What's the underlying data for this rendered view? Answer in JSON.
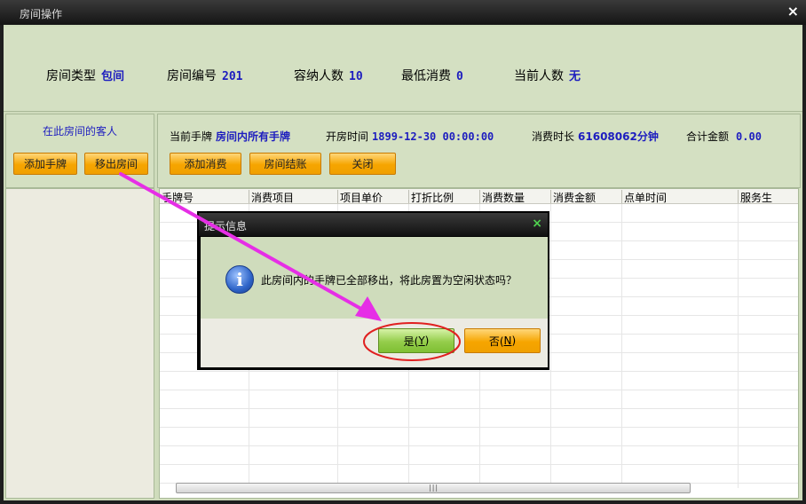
{
  "window": {
    "title": "房间操作",
    "close_label": "×"
  },
  "room_info": {
    "type_label": "房间类型",
    "type_value": "包间",
    "number_label": "房间编号",
    "number_value": "201",
    "capacity_label": "容纳人数",
    "capacity_value": "10",
    "min_spend_label": "最低消费",
    "min_spend_value": "0",
    "current_people_label": "当前人数",
    "current_people_value": "无"
  },
  "guests": {
    "heading": "在此房间的客人",
    "add_button": "添加手牌",
    "remove_button": "移出房间"
  },
  "session": {
    "card_label": "当前手牌",
    "card_value": "房间内所有手牌",
    "open_time_label": "开房时间",
    "open_time_value": "1899-12-30 00:00:00",
    "duration_label": "消费时长",
    "duration_value": "61608062分钟",
    "total_label": "合计金额",
    "total_value": "0.00",
    "add_consumption_button": "添加消费",
    "checkout_button": "房间结账",
    "close_button": "关闭"
  },
  "table": {
    "columns": [
      "手牌号",
      "消费项目",
      "项目单价",
      "打折比例",
      "消费数量",
      "消费金额",
      "点单时间",
      "服务生"
    ],
    "rows": []
  },
  "dialog": {
    "title": "提示信息",
    "close_label": "×",
    "icon": "info-icon",
    "message": "此房间内的手牌已全部移出，将此房置为空闲状态吗？",
    "yes_label": "是(",
    "yes_key": "Y",
    "yes_suffix": ")",
    "no_label": "否(",
    "no_key": "N",
    "no_suffix": ")"
  },
  "annotation": {
    "arrow_color": "#e62ee6",
    "circle_color": "#e02020"
  }
}
